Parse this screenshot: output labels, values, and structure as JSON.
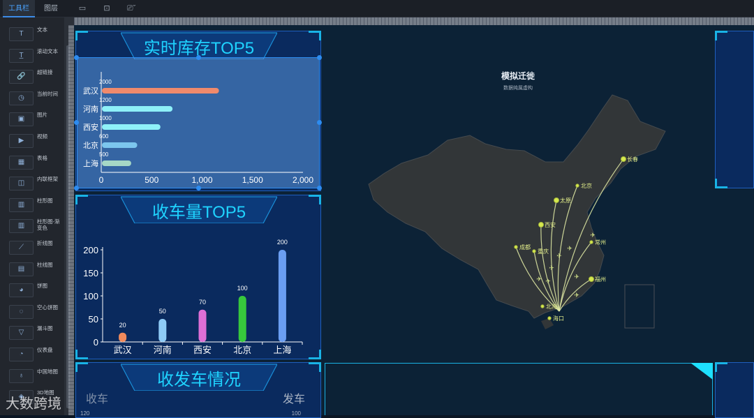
{
  "topbar": {
    "tabs": [
      {
        "label": "工具栏"
      },
      {
        "label": "图层"
      }
    ],
    "icons": [
      "save-icon",
      "screenshot-icon",
      "preview-icon"
    ]
  },
  "sidebar": {
    "items": [
      {
        "label": "文本",
        "icon": "text-icon",
        "glyph": "T"
      },
      {
        "label": "滚动文本",
        "icon": "scroll-text-icon",
        "glyph": "T̲"
      },
      {
        "label": "超链接",
        "icon": "link-icon",
        "glyph": "🔗"
      },
      {
        "label": "当前时间",
        "icon": "clock-icon",
        "glyph": "◷"
      },
      {
        "label": "图片",
        "icon": "image-icon",
        "glyph": "▣"
      },
      {
        "label": "视频",
        "icon": "video-icon",
        "glyph": "▶"
      },
      {
        "label": "表格",
        "icon": "table-icon",
        "glyph": "▦"
      },
      {
        "label": "内联框架",
        "icon": "iframe-icon",
        "glyph": "◫"
      },
      {
        "label": "柱形图",
        "icon": "bar-chart-icon",
        "glyph": "▥"
      },
      {
        "label": "柱形图-渐变色",
        "icon": "gradient-bar-icon",
        "glyph": "▥"
      },
      {
        "label": "折线图",
        "icon": "line-chart-icon",
        "glyph": "⟋"
      },
      {
        "label": "柱线图",
        "icon": "bar-line-icon",
        "glyph": "▤"
      },
      {
        "label": "饼图",
        "icon": "pie-chart-icon",
        "glyph": "◕"
      },
      {
        "label": "空心饼图",
        "icon": "donut-chart-icon",
        "glyph": "◌"
      },
      {
        "label": "漏斗图",
        "icon": "funnel-icon",
        "glyph": "▽"
      },
      {
        "label": "仪表盘",
        "icon": "gauge-icon",
        "glyph": "◔"
      },
      {
        "label": "中国地图",
        "icon": "china-map-icon",
        "glyph": "♁"
      },
      {
        "label": "3D地图",
        "icon": "map3d-icon",
        "glyph": "◈"
      }
    ]
  },
  "panels": {
    "stock": {
      "title": "实时库存TOP5"
    },
    "cars": {
      "title": "收车量TOP5"
    },
    "send": {
      "title": "收发车情况",
      "left_label": "收车",
      "right_label": "发车",
      "left_axis_top": "120",
      "right_axis_top": "100"
    }
  },
  "map": {
    "title": "模拟迁徙",
    "subtitle": "数据纯属虚构",
    "cities": [
      "长春",
      "北京",
      "太原",
      "西安",
      "成都",
      "重庆",
      "常州",
      "福州",
      "北海",
      "海口"
    ]
  },
  "watermark": "大数跨境",
  "colors": {
    "accent": "#1fd3ff",
    "panel_bg": "#0a2a5e",
    "border": "#1f5fbf"
  },
  "chart_data": [
    {
      "type": "bar",
      "orientation": "horizontal",
      "categories": [
        "武汉",
        "河南",
        "西安",
        "北京",
        "上海"
      ],
      "values": [
        2000,
        1200,
        1000,
        600,
        500
      ],
      "bar_values": [
        1160,
        700,
        580,
        350,
        290
      ],
      "xlim": [
        0,
        2000
      ],
      "xticks": [
        "0",
        "500",
        "1,000",
        "1,500",
        "2,000"
      ],
      "colors": [
        "#f08a6c",
        "#8ef0f8",
        "#8ef0f8",
        "#7cc6ee",
        "#a6d8c6"
      ]
    },
    {
      "type": "bar",
      "categories": [
        "武汉",
        "河南",
        "西安",
        "北京",
        "上海"
      ],
      "values": [
        20,
        50,
        70,
        100,
        200
      ],
      "ylim": [
        0,
        200
      ],
      "yticks": [
        "0",
        "50",
        "100",
        "150",
        "200"
      ],
      "colors": [
        "#f08a5c",
        "#8ecbf6",
        "#dd6fd6",
        "#37c83c",
        "#6b9ef2"
      ]
    }
  ]
}
